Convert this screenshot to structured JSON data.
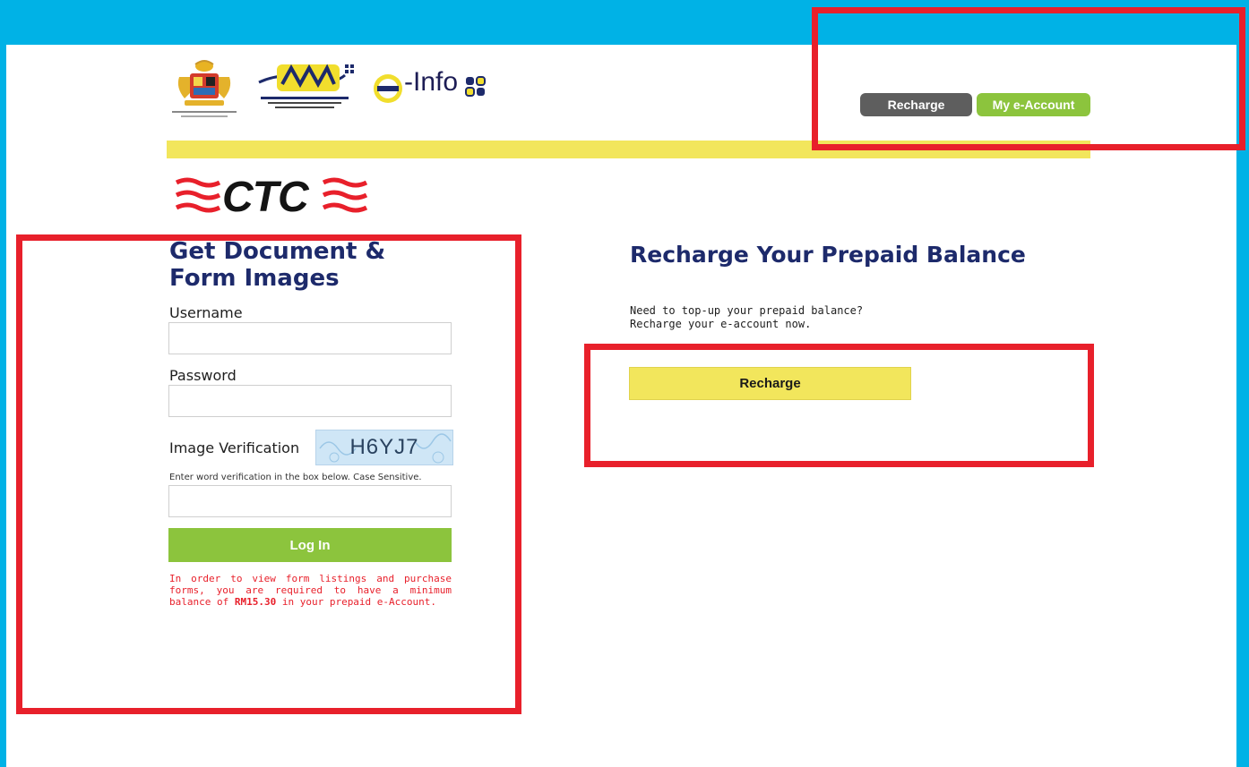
{
  "header": {
    "brand_e": "e",
    "brand_text": "-Info",
    "recharge_label": "Recharge",
    "account_label": "My e-Account"
  },
  "product": {
    "ctc_label": "CTC"
  },
  "login": {
    "title_line1": "Get Document &",
    "title_line2": "Form Images",
    "username_label": "Username",
    "username_value": "",
    "password_label": "Password",
    "password_value": "",
    "verification_label": "Image Verification",
    "captcha_code": "H6YJ7",
    "verification_hint": "Enter word verification in the box below. Case Sensitive.",
    "verification_value": "",
    "login_button": "Log In",
    "notice_text": "In order to view form listings and purchase forms, you are required to have a minimum balance of ",
    "notice_amount": "RM15.30",
    "notice_suffix": " in your prepaid e-Account."
  },
  "recharge": {
    "title": "Recharge Your Prepaid Balance",
    "line1": "Need to top-up your prepaid balance?",
    "line2": "Recharge your e-account now.",
    "button": "Recharge"
  },
  "colors": {
    "background": "#00b2e6",
    "accent_green": "#8cc43d",
    "accent_yellow": "#f2e65c",
    "title_navy": "#1d2a6b",
    "highlight_red": "#e8202b"
  }
}
